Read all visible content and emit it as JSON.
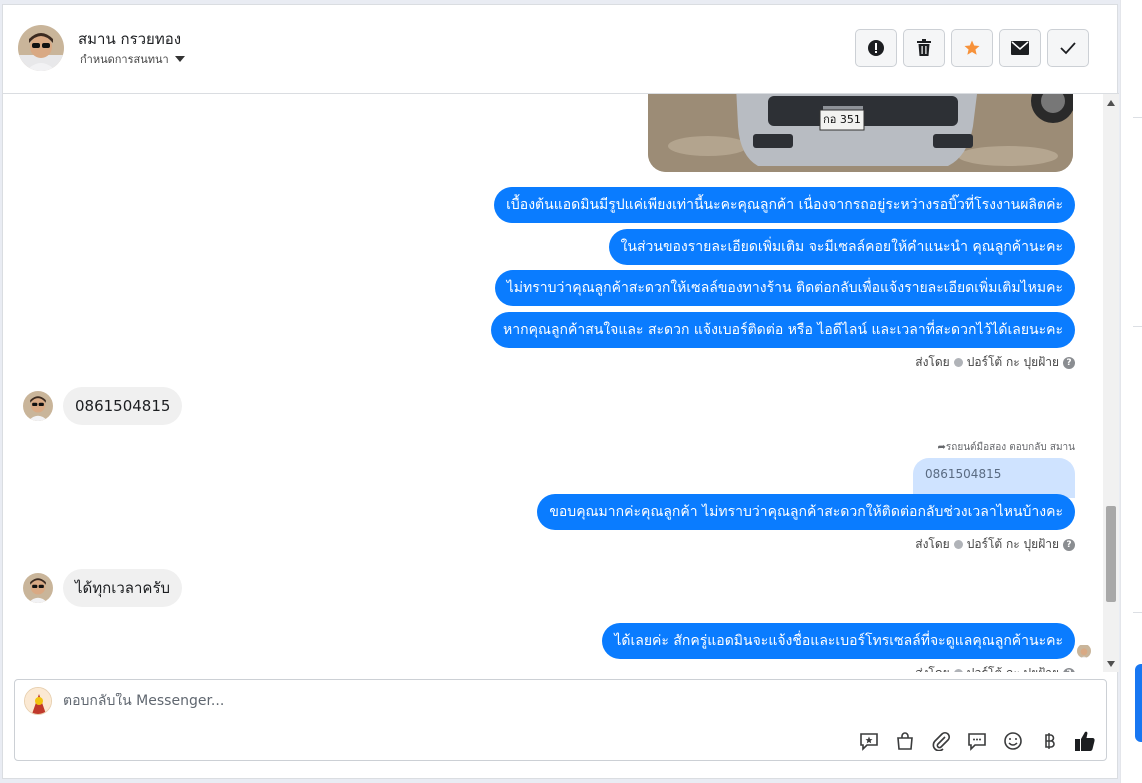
{
  "header": {
    "contact_name": "สมาน กรวยทอง",
    "assign_label": "กำหนดการสนทนา",
    "actions": [
      {
        "name": "mark-spam-button",
        "icon": "exclamation-icon"
      },
      {
        "name": "delete-button",
        "icon": "trash-icon"
      },
      {
        "name": "star-button",
        "icon": "star-icon"
      },
      {
        "name": "mark-unread-button",
        "icon": "envelope-icon"
      },
      {
        "name": "mark-done-button",
        "icon": "check-icon"
      }
    ]
  },
  "messages": {
    "out1": "เบื้องต้นแอดมินมีรูปแค่เพียงเท่านี้นะคะคุณลูกค้า เนื่องจากรถอยู่ระหว่างรอบิ๊วที่โรงงานผลิตค่ะ",
    "out2": "ในส่วนของรายละเอียดเพิ่มเติม จะมีเซลล์คอยให้คำแนะนำ คุณลูกค้านะคะ",
    "out3": "ไม่ทราบว่าคุณลูกค้าสะดวกให้เซลล์ของทางร้าน ติดต่อกลับเพื่อแจ้งรายละเอียดเพิ่มเติมไหมคะ",
    "out4": "หากคุณลูกค้าสนใจและ สะดวก แจ้งเบอร์ติดต่อ หรือ ไอดีไลน์ และเวลาที่สะดวกไว้ได้เลยนะคะ",
    "sent_by_1": "ส่งโดย",
    "sender_1": "ปอร์โต้ กะ ปุยฝ้าย",
    "in1": "0861504815",
    "reply_note": "รถยนต์มือสอง ตอบกลับ สมาน",
    "quoted": "0861504815",
    "out5": "ขอบคุณมากค่ะคุณลูกค้า ไม่ทราบว่าคุณลูกค้าสะดวกให้ติดต่อกลับช่วงเวลาไหนบ้างคะ",
    "sent_by_2": "ส่งโดย",
    "sender_2": "ปอร์โต้ กะ ปุยฝ้าย",
    "in2": "ได้ทุกเวลาครับ",
    "out6": "ได้เลยค่ะ สักครู่แอดมินจะแจ้งชื่อและเบอร์โทรเซลล์ที่จะดูแลคุณลูกค้านะคะ",
    "sent_by_3": "ส่งโดย",
    "sender_3": "ปอร์โต้ กะ ปุยฝ้าย",
    "license_plate": "กอ 351"
  },
  "composer": {
    "placeholder": "ตอบกลับใน Messenger...",
    "tools": [
      "saved-reply-icon",
      "shop-bag-icon",
      "paperclip-icon",
      "chat-bubble-icon",
      "emoji-icon",
      "baht-icon",
      "thumbs-up-icon"
    ]
  },
  "colors": {
    "outgoing_bubble": "#0a7cff",
    "incoming_bubble": "#f0f0f0",
    "star": "#f7923a"
  }
}
